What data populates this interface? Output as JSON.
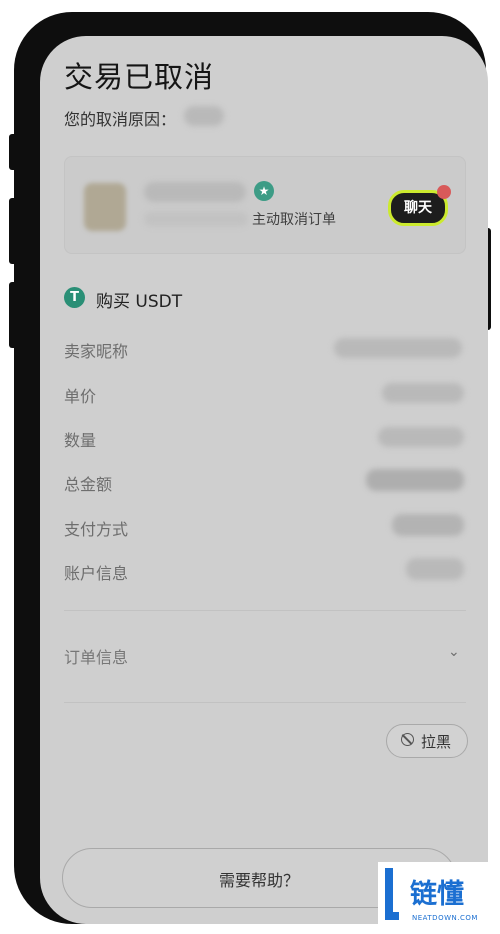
{
  "page": {
    "title": "交易已取消",
    "reason_label": "您的取消原因："
  },
  "counterparty_card": {
    "subtitle": "主动取消订单",
    "chat_button_label": "聊天",
    "verified_icon": "verified-star-icon"
  },
  "order": {
    "header_label": "购买 USDT",
    "currency_icon": "tether-icon",
    "rows": [
      {
        "label": "卖家昵称"
      },
      {
        "label": "单价"
      },
      {
        "label": "数量"
      },
      {
        "label": "总金额"
      },
      {
        "label": "支付方式"
      },
      {
        "label": "账户信息"
      }
    ],
    "order_info_label": "订单信息"
  },
  "actions": {
    "block_label": "拉黑",
    "help_label": "需要帮助？"
  },
  "watermark": {
    "text": "链懂",
    "subtext": "NEATDOWN.COM"
  },
  "colors": {
    "accent_outline": "#ccea2e",
    "tether_green": "#2a8f76",
    "watermark_blue": "#1b6fd1"
  }
}
